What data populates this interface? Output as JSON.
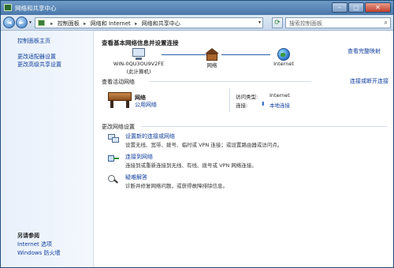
{
  "window": {
    "title": "网络和共享中心"
  },
  "titlebar_buttons": {
    "minimize": "–",
    "maximize": "□",
    "close": "✕"
  },
  "address": {
    "segments": [
      "控制面板",
      "网络和 Internet",
      "网络和共享中心"
    ],
    "search_placeholder": "搜索控制面板",
    "back_glyph": "◄",
    "forward_glyph": "►",
    "refresh_glyph": "⟳",
    "search_glyph": "⌕"
  },
  "sidebar": {
    "links": [
      "控制面板主页",
      "更改适配器设置",
      "更改高级共享设置"
    ],
    "see_also_title": "另请参阅",
    "see_also": [
      "Internet 选项",
      "Windows 防火墙"
    ]
  },
  "main": {
    "heading": "查看基本网络信息并设置连接",
    "full_map_link": "查看完整映射",
    "map": {
      "computer": {
        "name": "WIN-0QU3OU9V2FE",
        "sub": "(此计算机)"
      },
      "network": {
        "name": "网络"
      },
      "internet": {
        "name": "Internet"
      }
    },
    "active_section": {
      "title": "查看活动网络",
      "connect_link": "连接或断开连接",
      "network_name": "网络",
      "network_type": "公用网络",
      "access_type_label": "访问类型:",
      "access_type_value": "Internet",
      "connections_label": "连接:",
      "connections_value": "本地连接"
    },
    "change_section": {
      "title": "更改网络设置",
      "tasks": [
        {
          "title": "设置新的连接或网络",
          "desc": "设置无线、宽带、拨号、临时或 VPN 连接；或设置路由器或访问点。"
        },
        {
          "title": "连接到网络",
          "desc": "连接到或重新连接到无线、有线、拨号或 VPN 网络连接。"
        },
        {
          "title": "疑难解答",
          "desc": "诊断并修复网络问题，或获得故障排除信息。"
        }
      ]
    }
  },
  "help": "?"
}
